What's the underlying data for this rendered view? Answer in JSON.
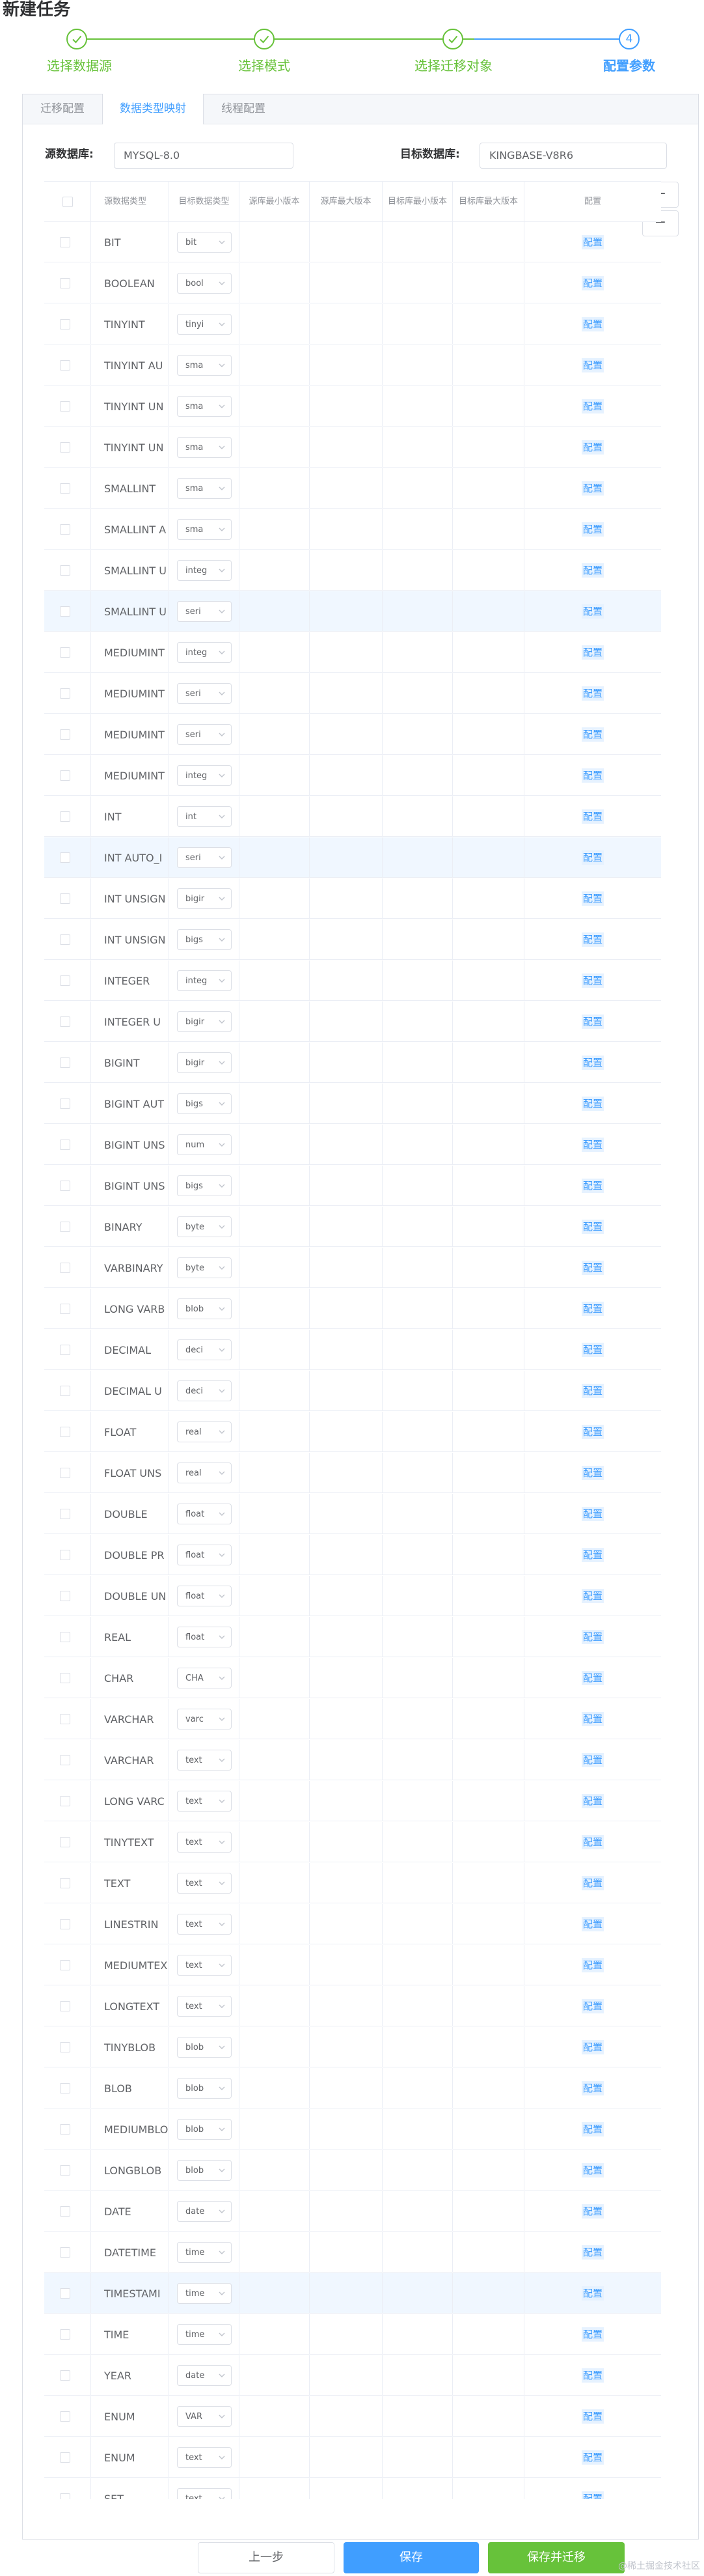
{
  "page": {
    "title": "新建任务"
  },
  "steps": [
    {
      "label": "选择数据源",
      "status": "done"
    },
    {
      "label": "选择模式",
      "status": "done"
    },
    {
      "label": "选择迁移对象",
      "status": "done"
    },
    {
      "label": "配置参数",
      "status": "active",
      "number": "4"
    }
  ],
  "tabs": [
    {
      "label": "迁移配置",
      "active": false
    },
    {
      "label": "数据类型映射",
      "active": true
    },
    {
      "label": "线程配置",
      "active": false
    }
  ],
  "source_db": {
    "label": "源数据库:",
    "value": "MYSQL-8.0"
  },
  "target_db": {
    "label": "目标数据库:",
    "value": "KINGBASE-V8R6"
  },
  "table": {
    "headers": {
      "source_type": "源数据类型",
      "target_type": "目标数据类型",
      "src_min": "源库最小版本",
      "src_max": "源库最大版本",
      "tgt_min": "目标库最小版本",
      "tgt_max": "目标库最大版本",
      "config": "配置"
    },
    "config_label": "配置",
    "rows": [
      {
        "source": "BIT",
        "target": "bit"
      },
      {
        "source": "BOOLEAN",
        "target": "bool"
      },
      {
        "source": "TINYINT",
        "target": "tinyi"
      },
      {
        "source": "TINYINT AU",
        "target": "sma"
      },
      {
        "source": "TINYINT UN",
        "target": "sma"
      },
      {
        "source": "TINYINT UN",
        "target": "sma"
      },
      {
        "source": "SMALLINT",
        "target": "sma"
      },
      {
        "source": "SMALLINT A",
        "target": "sma"
      },
      {
        "source": "SMALLINT U",
        "target": "integ"
      },
      {
        "source": "SMALLINT U",
        "target": "seri",
        "highlight": true
      },
      {
        "source": "MEDIUMINT",
        "target": "integ"
      },
      {
        "source": "MEDIUMINT",
        "target": "seri"
      },
      {
        "source": "MEDIUMINT",
        "target": "seri"
      },
      {
        "source": "MEDIUMINT",
        "target": "integ"
      },
      {
        "source": "INT",
        "target": "int"
      },
      {
        "source": "INT AUTO_I",
        "target": "seri",
        "highlight": true
      },
      {
        "source": "INT UNSIGN",
        "target": "bigir"
      },
      {
        "source": "INT UNSIGN",
        "target": "bigs"
      },
      {
        "source": "INTEGER",
        "target": "integ"
      },
      {
        "source": "INTEGER U",
        "target": "bigir"
      },
      {
        "source": "BIGINT",
        "target": "bigir"
      },
      {
        "source": "BIGINT AUT",
        "target": "bigs"
      },
      {
        "source": "BIGINT UNS",
        "target": "num"
      },
      {
        "source": "BIGINT UNS",
        "target": "bigs"
      },
      {
        "source": "BINARY",
        "target": "byte"
      },
      {
        "source": "VARBINARY",
        "target": "byte"
      },
      {
        "source": "LONG VARB",
        "target": "blob"
      },
      {
        "source": "DECIMAL",
        "target": "deci"
      },
      {
        "source": "DECIMAL U",
        "target": "deci"
      },
      {
        "source": "FLOAT",
        "target": "real"
      },
      {
        "source": "FLOAT UNS",
        "target": "real"
      },
      {
        "source": "DOUBLE",
        "target": "float"
      },
      {
        "source": "DOUBLE PR",
        "target": "float"
      },
      {
        "source": "DOUBLE UN",
        "target": "float"
      },
      {
        "source": "REAL",
        "target": "float"
      },
      {
        "source": "CHAR",
        "target": "CHA"
      },
      {
        "source": "VARCHAR",
        "target": "varc"
      },
      {
        "source": "VARCHAR",
        "target": "text"
      },
      {
        "source": "LONG VARC",
        "target": "text"
      },
      {
        "source": "TINYTEXT",
        "target": "text"
      },
      {
        "source": "TEXT",
        "target": "text"
      },
      {
        "source": "LINESTRIN",
        "target": "text"
      },
      {
        "source": "MEDIUMTEX",
        "target": "text"
      },
      {
        "source": "LONGTEXT",
        "target": "text"
      },
      {
        "source": "TINYBLOB",
        "target": "blob"
      },
      {
        "source": "BLOB",
        "target": "blob"
      },
      {
        "source": "MEDIUMBLO",
        "target": "blob"
      },
      {
        "source": "LONGBLOB",
        "target": "blob"
      },
      {
        "source": "DATE",
        "target": "date"
      },
      {
        "source": "DATETIME",
        "target": "time"
      },
      {
        "source": "TIMESTAMI",
        "target": "time",
        "highlight": true
      },
      {
        "source": "TIME",
        "target": "time"
      },
      {
        "source": "YEAR",
        "target": "date"
      },
      {
        "source": "ENUM",
        "target": "VAR"
      },
      {
        "source": "ENUM",
        "target": "text"
      },
      {
        "source": "SET",
        "target": "text"
      }
    ]
  },
  "side_buttons": {
    "add": "+",
    "remove": "−"
  },
  "footer": {
    "prev": "上一步",
    "save": "保存",
    "save_migrate": "保存并迁移"
  },
  "watermark": "@稀土掘金技术社区",
  "colors": {
    "primary": "#409eff",
    "success": "#67c23a",
    "border": "#dcdfe6",
    "highlight_row": "#f0f7ff"
  }
}
